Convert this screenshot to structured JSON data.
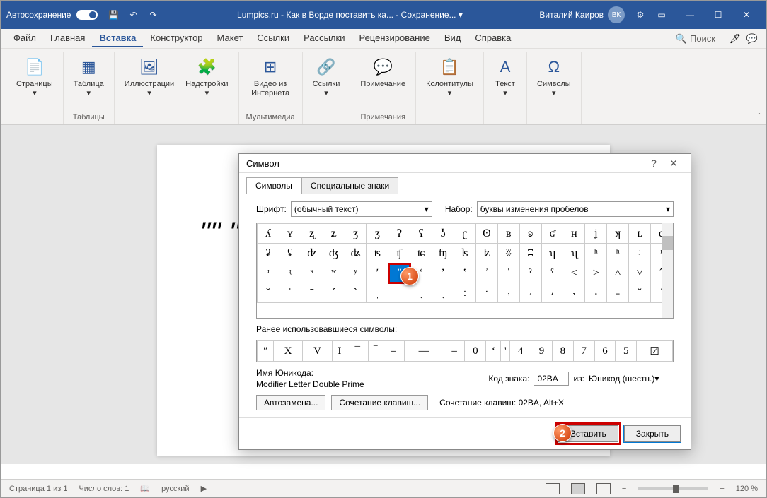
{
  "titlebar": {
    "autosave": "Автосохранение",
    "title": "Lumpics.ru - Как в Ворде поставить ка... - Сохранение... ▾",
    "user": "Виталий Каиров",
    "avatar": "ВК"
  },
  "tabs": {
    "items": [
      "Файл",
      "Главная",
      "Вставка",
      "Конструктор",
      "Макет",
      "Ссылки",
      "Рассылки",
      "Рецензирование",
      "Вид",
      "Справка"
    ],
    "activeIndex": 2,
    "search": "Поиск"
  },
  "ribbon": {
    "groups": [
      {
        "label": "",
        "buttons": [
          {
            "icon": "📄",
            "label": "Страницы\n▾"
          }
        ]
      },
      {
        "label": "Таблицы",
        "buttons": [
          {
            "icon": "▦",
            "label": "Таблица\n▾"
          }
        ]
      },
      {
        "label": "",
        "buttons": [
          {
            "icon": "🖼",
            "label": "Иллюстрации\n▾"
          },
          {
            "icon": "🧩",
            "label": "Надстройки\n▾"
          }
        ]
      },
      {
        "label": "Мультимедиа",
        "buttons": [
          {
            "icon": "⊞",
            "label": "Видео из\nИнтернета"
          }
        ]
      },
      {
        "label": "",
        "buttons": [
          {
            "icon": "🔗",
            "label": "Ссылки\n▾"
          }
        ]
      },
      {
        "label": "Примечания",
        "buttons": [
          {
            "icon": "💬",
            "label": "Примечание"
          }
        ]
      },
      {
        "label": "",
        "buttons": [
          {
            "icon": "📋",
            "label": "Колонтитулы\n▾"
          }
        ]
      },
      {
        "label": "",
        "buttons": [
          {
            "icon": "A",
            "label": "Текст\n▾"
          }
        ]
      },
      {
        "label": "",
        "buttons": [
          {
            "icon": "Ω",
            "label": "Символы\n▾"
          }
        ]
      }
    ]
  },
  "page": {
    "content": "ʺʺ ʺʺ"
  },
  "dialog": {
    "title": "Символ",
    "tabs": [
      "Символы",
      "Специальные знаки"
    ],
    "fontLabel": "Шрифт:",
    "fontValue": "(обычный текст)",
    "subsetLabel": "Набор:",
    "subsetValue": "буквы изменения пробелов",
    "grid": [
      [
        "ʎ",
        "ʏ",
        "ʐ",
        "ʑ",
        "ʒ",
        "ʓ",
        "ʔ",
        "ʕ",
        "ʖ",
        "ʗ",
        "ʘ",
        "ʙ",
        "ʚ",
        "ʛ",
        "ʜ",
        "ʝ",
        "ʞ",
        "ʟ",
        "ʠ"
      ],
      [
        "ʡ",
        "ʢ",
        "ʣ",
        "ʤ",
        "ʥ",
        "ʦ",
        "ʧ",
        "ʨ",
        "ʩ",
        "ʪ",
        "ʫ",
        "ʬ",
        "ʭ",
        "ʮ",
        "ʯ",
        "ʰ",
        "ʱ",
        "ʲ",
        "ʳ"
      ],
      [
        "ʴ",
        "ʵ",
        "ʶ",
        "ʷ",
        "ʸ",
        "ʹ",
        "ʺ",
        "ʻ",
        "ʼ",
        "ʽ",
        "ʾ",
        "ʿ",
        "ˀ",
        "ˁ",
        "˂",
        "˃",
        "˄",
        "˅",
        "ˆ"
      ],
      [
        "ˇ",
        "ˈ",
        "ˉ",
        "ˊ",
        "ˋ",
        "ˌ",
        "ˍ",
        "ˎ",
        "ˏ",
        "ː",
        "ˑ",
        "˒",
        "˓",
        "˔",
        "˕",
        "˖",
        "˗",
        "˘",
        "˙"
      ]
    ],
    "selectedRow": 2,
    "selectedCol": 6,
    "recentLabel": "Ранее использовавшиеся символы:",
    "recent": [
      "ʺ",
      "X",
      "V",
      "I",
      "¯",
      "‾",
      "‒",
      "—",
      "–",
      "0",
      "‘",
      "'",
      "4",
      "9",
      "8",
      "7",
      "6",
      "5",
      "☑"
    ],
    "unicodeNameLabel": "Имя Юникода:",
    "unicodeName": "Modifier Letter Double Prime",
    "codeLabel": "Код знака:",
    "codeValue": "02BA",
    "fromLabel": "из:",
    "fromValue": "Юникод (шестн.)",
    "autoReplace": "Автозамена...",
    "shortcut": "Сочетание клавиш...",
    "shortcutInfo": "Сочетание клавиш: 02BA, Alt+X",
    "insert": "Вставить",
    "close": "Закрыть"
  },
  "statusbar": {
    "page": "Страница 1 из 1",
    "words": "Число слов: 1",
    "lang": "русский",
    "zoom": "120 %"
  },
  "badges": {
    "one": "1",
    "two": "2"
  }
}
